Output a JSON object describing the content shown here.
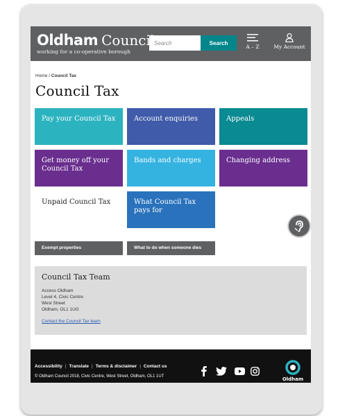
{
  "header": {
    "logo_bold": "Oldham",
    "logo_light": "Council",
    "tagline": "working for a co-operative borough",
    "search_placeholder": "Search",
    "search_button": "Search",
    "az_label": "A – Z",
    "account_label": "My Account"
  },
  "breadcrumb": {
    "home": "Home",
    "separator": "/",
    "current": "Council Tax"
  },
  "page_title": "Council Tax",
  "tiles": [
    {
      "label": "Pay your Council Tax",
      "color": "#2cb3c0"
    },
    {
      "label": "Account enquiries",
      "color": "#3f5ba9"
    },
    {
      "label": "Appeals",
      "color": "#0a8a92"
    },
    {
      "label": "Get money off your Council Tax",
      "color": "#6a2e8e"
    },
    {
      "label": "Bands and charges",
      "color": "#34b3e0"
    },
    {
      "label": "Changing address",
      "color": "#6a2e8e"
    },
    {
      "label": "Unpaid Council Tax",
      "color": "#ffffff"
    },
    {
      "label": "What Council Tax pays for",
      "color": "#2a72bc"
    }
  ],
  "buttons": {
    "exempt": "Exempt properties",
    "someone_dies": "What to do when someone dies"
  },
  "contact": {
    "title": "Council Tax Team",
    "address": [
      "Access Oldham",
      "Level 4, Civic Centre",
      "West Street",
      "Oldham, OL1 1UG"
    ],
    "link": "Contact the Council Tax team"
  },
  "footer": {
    "links": [
      "Accessibility",
      "Translate",
      "Terms & disclaimer",
      "Contact us"
    ],
    "separator": "|",
    "copyright": "© Oldham Council 2018, Civic Centre, West Street, Oldham, OL1 1UT",
    "logo_text": "Oldham",
    "social": [
      "facebook-icon",
      "twitter-icon",
      "youtube-icon",
      "instagram-icon"
    ]
  },
  "colors": {
    "header_bg": "#5f6062",
    "search_teal": "#00868b",
    "footer_bg": "#111111",
    "contact_bg": "#dcdcdc"
  }
}
